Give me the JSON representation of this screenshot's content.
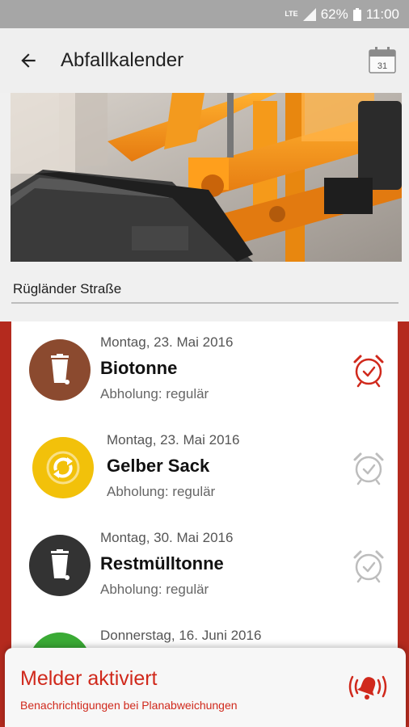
{
  "status_bar": {
    "network": "LTE",
    "battery": "62%",
    "time": "11:00"
  },
  "app_bar": {
    "title": "Abfallkalender",
    "calendar_day": "31"
  },
  "street": {
    "value": "Rügländer Straße"
  },
  "items": [
    {
      "date": "Montag, 23. Mai 2016",
      "name": "Biotonne",
      "status": "Abholung: regulär",
      "icon": "bin-icon",
      "color": "#8b4a2f",
      "alarm_active": true
    },
    {
      "date": "Montag, 23. Mai 2016",
      "name": "Gelber Sack",
      "status": "Abholung: regulär",
      "icon": "recycle-icon",
      "color": "#f2c10a",
      "alarm_active": false
    },
    {
      "date": "Montag, 30. Mai 2016",
      "name": "Restmülltonne",
      "status": "Abholung: regulär",
      "icon": "bin-icon",
      "color": "#333333",
      "alarm_active": false
    },
    {
      "date": "Donnerstag, 16. Juni 2016",
      "name": "",
      "status": "",
      "icon": "bin-icon",
      "color": "#3aaa35",
      "alarm_active": false
    }
  ],
  "banner": {
    "title": "Melder aktiviert",
    "subtitle": "Benachrichtigungen bei Planabweichungen"
  },
  "colors": {
    "accent": "#d0291c",
    "list_background": "#b42a1e",
    "alarm_active": "#d0291c",
    "alarm_inactive": "#bdbdbd"
  }
}
